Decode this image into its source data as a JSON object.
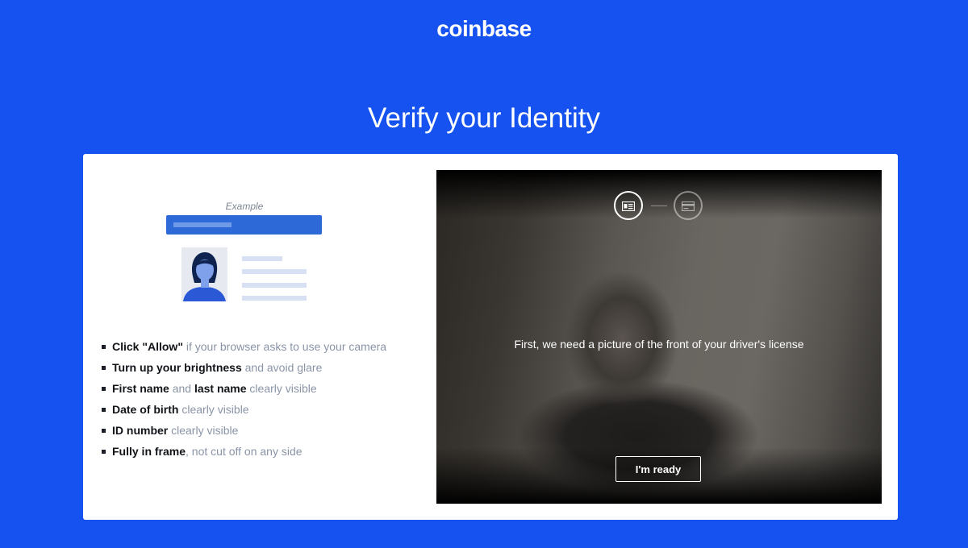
{
  "header": {
    "logo": "coinbase",
    "title": "Verify your Identity"
  },
  "example": {
    "label": "Example",
    "icons": {
      "card_photo": "person-avatar",
      "step1": "id-card-front-icon",
      "step2": "id-card-back-icon"
    }
  },
  "instructions": [
    {
      "strong": "Click \"Allow\"",
      "rest": " if your browser asks to use your camera"
    },
    {
      "strong": "Turn up your brightness",
      "rest": " and avoid glare"
    },
    {
      "strong": "First name",
      "mid": " and ",
      "strong2": "last name",
      "rest": " clearly visible"
    },
    {
      "strong": "Date of birth",
      "rest": " clearly visible"
    },
    {
      "strong": "ID number",
      "rest": " clearly visible"
    },
    {
      "strong": "Fully in frame",
      "rest": ", not cut off on any side"
    }
  ],
  "camera": {
    "prompt": "First, we need a picture of the front of your driver's license",
    "button": "I'm ready"
  },
  "colors": {
    "brand": "#1652f0",
    "card_bar": "#2e6ad7",
    "text_muted": "#8a94a6"
  }
}
